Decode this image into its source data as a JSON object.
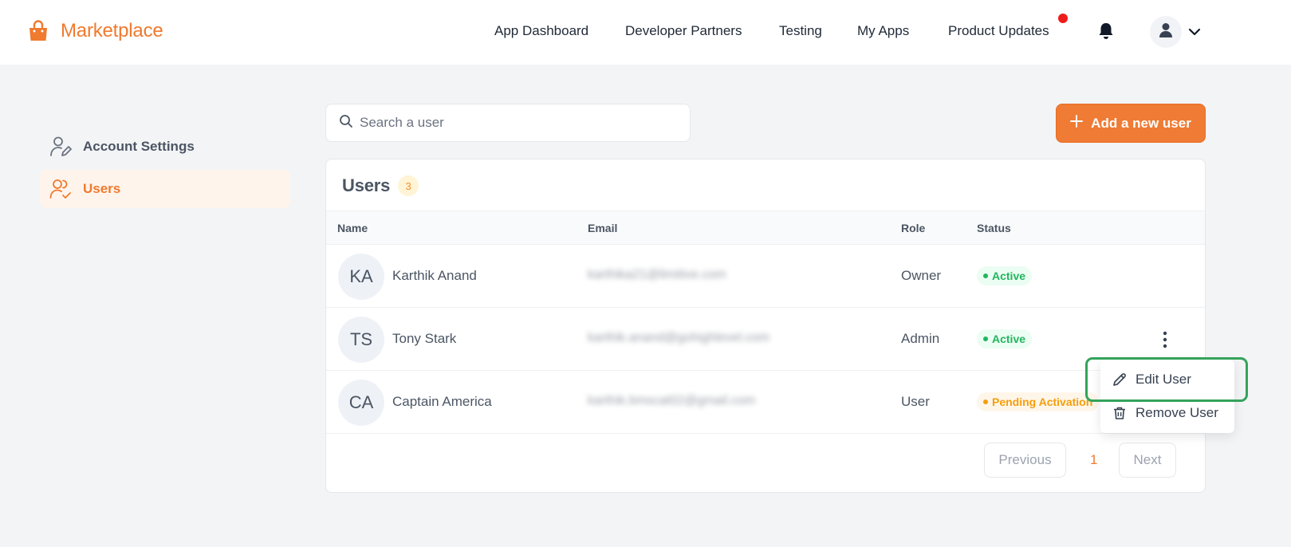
{
  "header": {
    "brand": "Marketplace",
    "nav": [
      "App Dashboard",
      "Developer Partners",
      "Testing",
      "My Apps",
      "Product Updates"
    ]
  },
  "sidebar": {
    "items": [
      {
        "label": "Account Settings",
        "icon": "user-edit-icon"
      },
      {
        "label": "Users",
        "icon": "users-check-icon"
      }
    ]
  },
  "search": {
    "placeholder": "Search a user",
    "value": ""
  },
  "add_button": {
    "label": "Add a new user"
  },
  "users_card": {
    "title": "Users",
    "count": "3",
    "columns": [
      "Name",
      "Email",
      "Role",
      "Status"
    ],
    "rows": [
      {
        "initials": "KA",
        "name": "Karthik Anand",
        "email": "karthika21@limitive.com",
        "role": "Owner",
        "status": "Active"
      },
      {
        "initials": "TS",
        "name": "Tony Stark",
        "email": "karthik.anand@gohighlevel.com",
        "role": "Admin",
        "status": "Active"
      },
      {
        "initials": "CA",
        "name": "Captain America",
        "email": "karthik.bmscat02@gmail.com",
        "role": "User",
        "status": "Pending Activation"
      }
    ],
    "pagination": {
      "previous": "Previous",
      "page": "1",
      "next": "Next"
    }
  },
  "row_menu": {
    "items": [
      {
        "label": "Edit User",
        "icon": "pencil-icon"
      },
      {
        "label": "Remove User",
        "icon": "trash-icon"
      }
    ]
  },
  "colors": {
    "accent": "#f07a2e",
    "active_status": "#22b55e",
    "pending_status": "#f59e0b",
    "notification_dot": "#ef1c1c",
    "highlight_outline": "#34a35b"
  }
}
